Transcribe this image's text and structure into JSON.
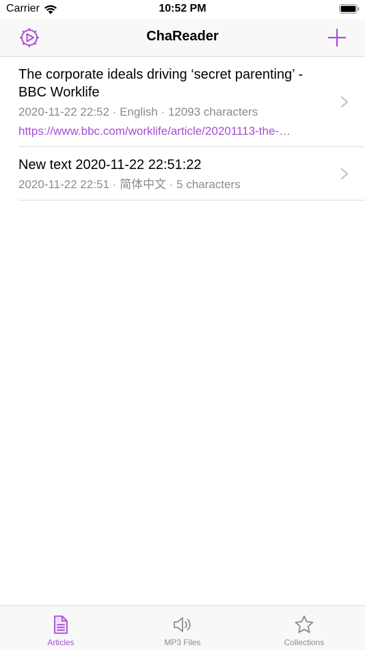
{
  "status_bar": {
    "carrier": "Carrier",
    "time": "10:52 PM"
  },
  "nav": {
    "title": "ChaReader",
    "left_icon": "settings-dial-icon",
    "right_icon": "plus-icon"
  },
  "colors": {
    "accent": "#a84cd6",
    "secondary_text": "#8a8a8e",
    "chevron": "#c4c4c7"
  },
  "articles": [
    {
      "title": "The corporate ideals driving ‘secret parenting’ - BBC Worklife",
      "meta": "2020-11-22 22:52 · English · 12093 characters",
      "url": "https://www.bbc.com/worklife/article/20201113-the-…"
    },
    {
      "title": "New text 2020-11-22 22:51:22",
      "meta": "2020-11-22 22:51 · 简体中文 · 5 characters"
    }
  ],
  "tabs": [
    {
      "label": "Articles",
      "icon": "document-icon",
      "active": true
    },
    {
      "label": "MP3 Files",
      "icon": "speaker-icon",
      "active": false
    },
    {
      "label": "Collections",
      "icon": "star-icon",
      "active": false
    }
  ]
}
